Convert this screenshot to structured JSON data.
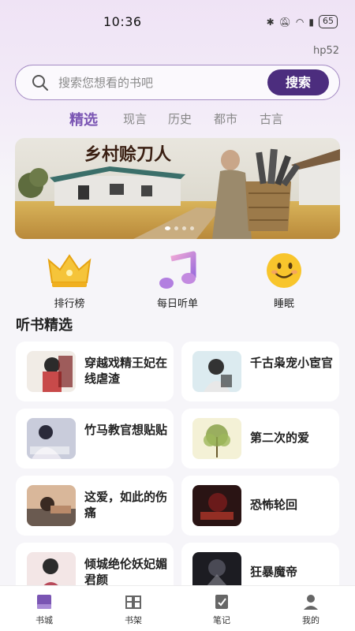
{
  "status_bar": {
    "time": "10:36",
    "battery": "65"
  },
  "user_tag": "hp52",
  "search": {
    "placeholder": "搜索您想看的书吧",
    "button": "搜索"
  },
  "tabs": [
    {
      "label": "精选",
      "active": true
    },
    {
      "label": "现言",
      "active": false
    },
    {
      "label": "历史",
      "active": false
    },
    {
      "label": "都市",
      "active": false
    },
    {
      "label": "古言",
      "active": false
    }
  ],
  "banner": {
    "title": "乡村赊刀人",
    "slide_count": 4,
    "active_slide": 1
  },
  "quick_links": [
    {
      "label": "排行榜",
      "icon": "crown-icon"
    },
    {
      "label": "每日听单",
      "icon": "music-note-icon"
    },
    {
      "label": "睡眠",
      "icon": "smiley-icon"
    }
  ],
  "section": {
    "title": "听书精选"
  },
  "books": [
    {
      "title": "穿越戏精王妃在线虐渣"
    },
    {
      "title": "千古枭宠小宦官"
    },
    {
      "title": "竹马教官想贴贴"
    },
    {
      "title": "第二次的爱"
    },
    {
      "title": "这爱，如此的伤痛"
    },
    {
      "title": "恐怖轮回"
    },
    {
      "title": "倾城绝伦妖妃媚君颜"
    },
    {
      "title": "狂暴魔帝"
    }
  ],
  "bottom_nav": [
    {
      "label": "书城",
      "icon": "book-city-icon",
      "active": true
    },
    {
      "label": "书架",
      "icon": "bookshelf-icon",
      "active": false
    },
    {
      "label": "笔记",
      "icon": "notes-icon",
      "active": false
    },
    {
      "label": "我的",
      "icon": "profile-icon",
      "active": false
    }
  ],
  "colors": {
    "accent": "#7a55b3",
    "button": "#4c2d7e",
    "border": "#a58cc4"
  }
}
